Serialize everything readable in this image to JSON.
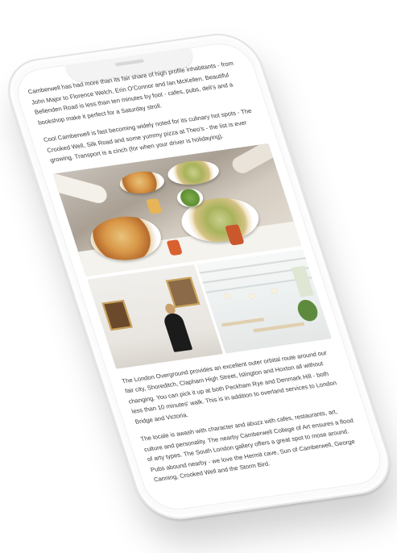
{
  "article": {
    "paragraphs": [
      "Camberwell has had more than its fair share of high profile inhabitants - from John Major to Florence Welch, Erin O'Connor and Ian McKellen. Beautiful Bellenden Road is less than ten minutes by foot - cafes, pubs, deli's and a bookshop make it perfect for a Saturday stroll.",
      "Cool Camberwell is fast becoming widely noted for its culinary hot spots - The Crooked Well, Silk Road and some yummy pizza at Theo's - the list is ever growing. Transport is a cinch (for when your driver is holidaying).",
      "The London Overground provides an excellent outer orbital route around our fair city, Shoreditch, Clapham High Street, Islington and Hoxton all without changing. You can pick it up at both Peckham Rye and Denmark Hill - both less than 10 minutes' walk. This is in addition to overland services to London Bridge and Victoria.",
      "The locale is awash with character and abuzz with cafes, restaurants, art, culture and personality. The nearby Camberwell College of Art ensures a flood of arty types. The South London gallery offers a great spot to mose around. Pubs abound nearby - we love the Hermit cave, Sun of Camberwell, George Canning, Crooked Well and the Storm Bird."
    ]
  },
  "colors": {
    "text": "#3a3a3a",
    "phone_frame": "#fbfbfb",
    "background": "#ffffff"
  },
  "icons": [
    "phone-speaker-icon"
  ]
}
